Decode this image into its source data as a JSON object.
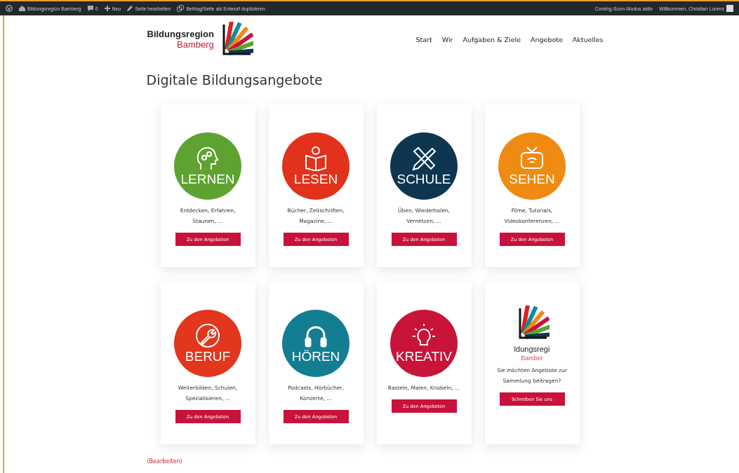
{
  "admin_bar": {
    "site": "Bildungsregion Bamberg",
    "comments": "0",
    "new": "Neu",
    "edit": "Seite bearbeiten",
    "duplicate": "Beitrag/Seite als Entwurf duplizieren",
    "coming_soon": "Coming-Soon-Modus aktiv",
    "welcome": "Willkommen, Christian Lorenz"
  },
  "logo": {
    "line1": "Bildungsregion",
    "line2": "Bamberg"
  },
  "nav": [
    "Start",
    "Wir",
    "Aufgaben & Ziele",
    "Angebote",
    "Aktuelles"
  ],
  "title": "Digitale Bildungsangebote",
  "cards": [
    {
      "kind": "category",
      "label": "LERNEN",
      "color": "#5ea330",
      "text": "Entdecken, Erfahren, Staunen, ...",
      "button": "Zu den Angeboten"
    },
    {
      "kind": "category",
      "label": "LESEN",
      "color": "#e2321b",
      "text": "Bücher, Zeitschriften, Magazine, ...",
      "button": "Zu den Angeboten"
    },
    {
      "kind": "category",
      "label": "SCHULE",
      "color": "#0e3650",
      "text": "Üben, Wiederholen, Vernetzen, ...",
      "button": "Zu den Angeboten"
    },
    {
      "kind": "category",
      "label": "SEHEN",
      "color": "#ef8a12",
      "text": "Filme, Tutorials, Videokonferenzen, ...",
      "button": "Zu den Angeboten"
    },
    {
      "kind": "category",
      "label": "BERUF",
      "color": "#e2361d",
      "text": "Weiterbilden, Schulen, Spezialisieren, ...",
      "button": "Zu den Angeboten"
    },
    {
      "kind": "category",
      "label": "HÖREN",
      "color": "#137d92",
      "text": "Podcasts, Hörbücher, Konzerte, ...",
      "button": "Zu den Angeboten"
    },
    {
      "kind": "category",
      "label": "KREATIV",
      "color": "#c9143a",
      "text": "Basteln, Malen, Knobeln, ...",
      "button": "Zu den Angeboten"
    },
    {
      "kind": "contact",
      "logo_line1": "ldungsregi",
      "logo_line2": "Bamber",
      "text": "Sie möchten Angebote zur Sammlung beitragen?",
      "button": "Schreiben Sie uns"
    }
  ],
  "edit_link": "(Bearbeiten)"
}
